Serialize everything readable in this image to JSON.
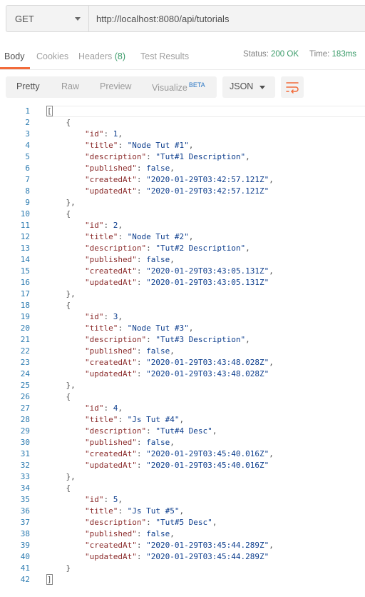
{
  "request": {
    "method": "GET",
    "url": "http://localhost:8080/api/tutorials"
  },
  "response_tabs": {
    "body": "Body",
    "cookies": "Cookies",
    "headers": "Headers",
    "headers_count": "(8)",
    "test_results": "Test Results"
  },
  "status": {
    "status_label": "Status:",
    "status_value": "200 OK",
    "time_label": "Time:",
    "time_value": "183ms"
  },
  "view_modes": {
    "pretty": "Pretty",
    "raw": "Raw",
    "preview": "Preview",
    "visualize": "Visualize",
    "beta": "BETA"
  },
  "format": {
    "selected": "JSON"
  },
  "colors": {
    "accent": "#f26b3a",
    "ok_green": "#3a9b69",
    "line_number_blue": "#2a7ab0",
    "key_red": "#8a2a2a",
    "value_blue": "#0b3c8c"
  },
  "icons": {
    "wrap": "wrap-lines-icon"
  },
  "tutorials": [
    {
      "id": "1",
      "title": "\"Node Tut #1\"",
      "description": "\"Tut#1 Description\"",
      "published": "false",
      "createdAt": "\"2020-01-29T03:42:57.121Z\"",
      "updatedAt": "\"2020-01-29T03:42:57.121Z\""
    },
    {
      "id": "2",
      "title": "\"Node Tut #2\"",
      "description": "\"Tut#2 Description\"",
      "published": "false",
      "createdAt": "\"2020-01-29T03:43:05.131Z\"",
      "updatedAt": "\"2020-01-29T03:43:05.131Z\""
    },
    {
      "id": "3",
      "title": "\"Node Tut #3\"",
      "description": "\"Tut#3 Description\"",
      "published": "false",
      "createdAt": "\"2020-01-29T03:43:48.028Z\"",
      "updatedAt": "\"2020-01-29T03:43:48.028Z\""
    },
    {
      "id": "4",
      "title": "\"Js Tut #4\"",
      "description": "\"Tut#4 Desc\"",
      "published": "false",
      "createdAt": "\"2020-01-29T03:45:40.016Z\"",
      "updatedAt": "\"2020-01-29T03:45:40.016Z\""
    },
    {
      "id": "5",
      "title": "\"Js Tut #5\"",
      "description": "\"Tut#5 Desc\"",
      "published": "false",
      "createdAt": "\"2020-01-29T03:45:44.289Z\"",
      "updatedAt": "\"2020-01-29T03:45:44.289Z\""
    }
  ],
  "line_count": 42
}
